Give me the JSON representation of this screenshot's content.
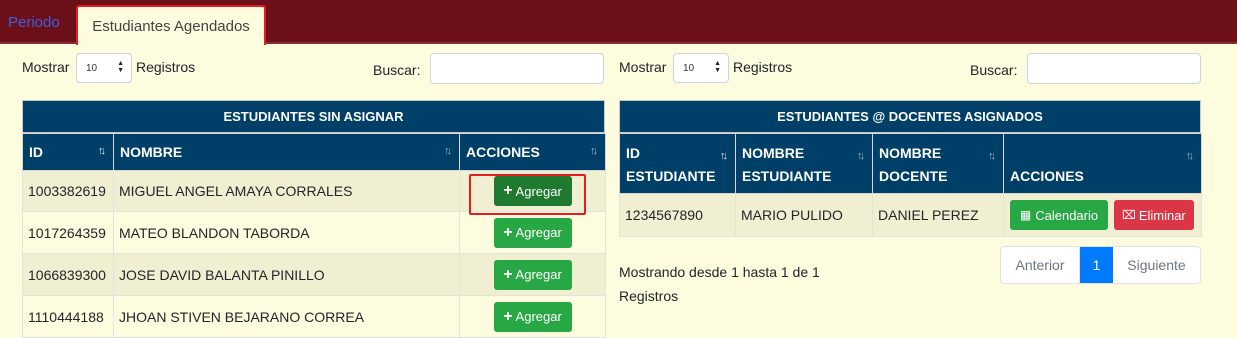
{
  "tabs": {
    "periodo": "Periodo",
    "agendados": "Estudiantes Agendados"
  },
  "left": {
    "show_label": "Mostrar",
    "page_size": "10",
    "records_label": "Registros",
    "search_label": "Buscar:",
    "title": "ESTUDIANTES SIN ASIGNAR",
    "columns": [
      "ID",
      "NOMBRE",
      "ACCIONES"
    ],
    "rows": [
      {
        "id": "1003382619",
        "nombre": "MIGUEL ANGEL AMAYA CORRALES"
      },
      {
        "id": "1017264359",
        "nombre": "MATEO BLANDON TABORDA"
      },
      {
        "id": "1066839300",
        "nombre": "JOSE DAVID BALANTA PINILLO"
      },
      {
        "id": "1110444188",
        "nombre": "JHOAN STIVEN BEJARANO CORREA"
      }
    ],
    "add_label": "Agregar"
  },
  "right": {
    "show_label": "Mostrar",
    "page_size": "10",
    "records_label": "Registros",
    "search_label": "Buscar:",
    "title": "ESTUDIANTES @ DOCENTES ASIGNADOS",
    "columns": [
      "ID ESTUDIANTE",
      "NOMBRE ESTUDIANTE",
      "NOMBRE DOCENTE",
      "ACCIONES"
    ],
    "rows": [
      {
        "id": "1234567890",
        "estudiante": "MARIO PULIDO",
        "docente": "DANIEL PEREZ"
      }
    ],
    "calendar_label": "Calendario",
    "delete_label": "Eliminar",
    "info_line1": "Mostrando desde 1 hasta 1 de 1",
    "info_line2": "Registros",
    "pager": {
      "prev": "Anterior",
      "current": "1",
      "next": "Siguiente"
    }
  },
  "colors": {
    "header": "#003f68",
    "topbar": "#6b1018",
    "success": "#28a745",
    "danger": "#dc3545",
    "primary": "#007bff"
  }
}
